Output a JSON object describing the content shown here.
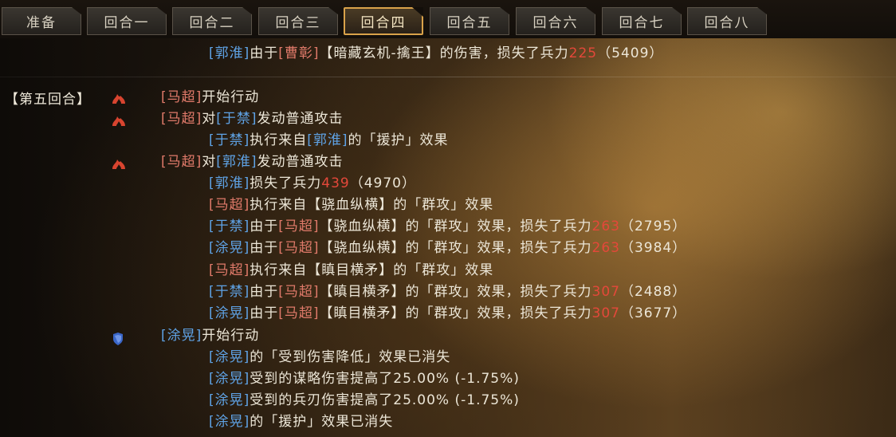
{
  "tabs": [
    {
      "label": "准备"
    },
    {
      "label": "回合一"
    },
    {
      "label": "回合二"
    },
    {
      "label": "回合三"
    },
    {
      "label": "回合四",
      "active": true
    },
    {
      "label": "回合五"
    },
    {
      "label": "回合六"
    },
    {
      "label": "回合七"
    },
    {
      "label": "回合八"
    }
  ],
  "round_label": "【第五回合】",
  "log": [
    {
      "segs": [
        [
          "[郭淮]",
          "blue"
        ],
        [
          "由于",
          ""
        ],
        [
          "[曹彰]",
          "red"
        ],
        [
          "【暗藏玄机-擒王】的伤害，损失了兵力",
          ""
        ],
        [
          "225",
          "num"
        ],
        [
          "（5409）",
          ""
        ]
      ]
    },
    {
      "segs": [
        [
          "[马超]",
          "red"
        ],
        [
          "开始行动",
          ""
        ]
      ]
    },
    {
      "segs": [
        [
          "[马超]",
          "red"
        ],
        [
          "对",
          ""
        ],
        [
          "[于禁]",
          "blue"
        ],
        [
          "发动普通攻击",
          ""
        ]
      ]
    },
    {
      "segs": [
        [
          "[于禁]",
          "blue"
        ],
        [
          "执行来自",
          ""
        ],
        [
          "[郭淮]",
          "blue"
        ],
        [
          "的「援护」效果",
          ""
        ]
      ]
    },
    {
      "segs": [
        [
          "[马超]",
          "red"
        ],
        [
          "对",
          ""
        ],
        [
          "[郭淮]",
          "blue"
        ],
        [
          "发动普通攻击",
          ""
        ]
      ]
    },
    {
      "segs": [
        [
          "[郭淮]",
          "blue"
        ],
        [
          "损失了兵力",
          ""
        ],
        [
          "439",
          "num"
        ],
        [
          "（4970）",
          ""
        ]
      ]
    },
    {
      "segs": [
        [
          "[马超]",
          "red"
        ],
        [
          "执行来自【骁血纵横】的「群攻」效果",
          ""
        ]
      ]
    },
    {
      "segs": [
        [
          "[于禁]",
          "blue"
        ],
        [
          "由于",
          ""
        ],
        [
          "[马超]",
          "red"
        ],
        [
          "【骁血纵横】的「群攻」效果，损失了兵力",
          ""
        ],
        [
          "263",
          "num"
        ],
        [
          "（2795）",
          ""
        ]
      ]
    },
    {
      "segs": [
        [
          "[涂晃]",
          "blue"
        ],
        [
          "由于",
          ""
        ],
        [
          "[马超]",
          "red"
        ],
        [
          "【骁血纵横】的「群攻」效果，损失了兵力",
          ""
        ],
        [
          "263",
          "num"
        ],
        [
          "（3984）",
          ""
        ]
      ]
    },
    {
      "segs": [
        [
          "[马超]",
          "red"
        ],
        [
          "执行来自【瞋目横矛】的「群攻」效果",
          ""
        ]
      ]
    },
    {
      "segs": [
        [
          "[于禁]",
          "blue"
        ],
        [
          "由于",
          ""
        ],
        [
          "[马超]",
          "red"
        ],
        [
          "【瞋目横矛】的「群攻」效果，损失了兵力",
          ""
        ],
        [
          "307",
          "num"
        ],
        [
          "（2488）",
          ""
        ]
      ]
    },
    {
      "segs": [
        [
          "[涂晃]",
          "blue"
        ],
        [
          "由于",
          ""
        ],
        [
          "[马超]",
          "red"
        ],
        [
          "【瞋目横矛】的「群攻」效果，损失了兵力",
          ""
        ],
        [
          "307",
          "num"
        ],
        [
          "（3677）",
          ""
        ]
      ]
    },
    {
      "segs": [
        [
          "[涂晃]",
          "blue"
        ],
        [
          "开始行动",
          ""
        ]
      ]
    },
    {
      "segs": [
        [
          "[涂晃]",
          "blue"
        ],
        [
          "的「受到伤害降低」效果已消失",
          ""
        ]
      ]
    },
    {
      "segs": [
        [
          "[涂晃]",
          "blue"
        ],
        [
          "受到的谋略伤害提高了25.00% (-1.75%)",
          ""
        ]
      ]
    },
    {
      "segs": [
        [
          "[涂晃]",
          "blue"
        ],
        [
          "受到的兵刃伤害提高了25.00% (-1.75%)",
          ""
        ]
      ]
    },
    {
      "segs": [
        [
          "[涂晃]",
          "blue"
        ],
        [
          "的「援护」效果已消失",
          ""
        ]
      ]
    }
  ],
  "icons": {
    "fire": "flame-icon",
    "shield": "shield-icon"
  },
  "colors": {
    "name_blue": "#5fa3e6",
    "name_red": "#e07a6a",
    "damage": "#e4483a",
    "active_tab_border": "#d9a24a"
  }
}
